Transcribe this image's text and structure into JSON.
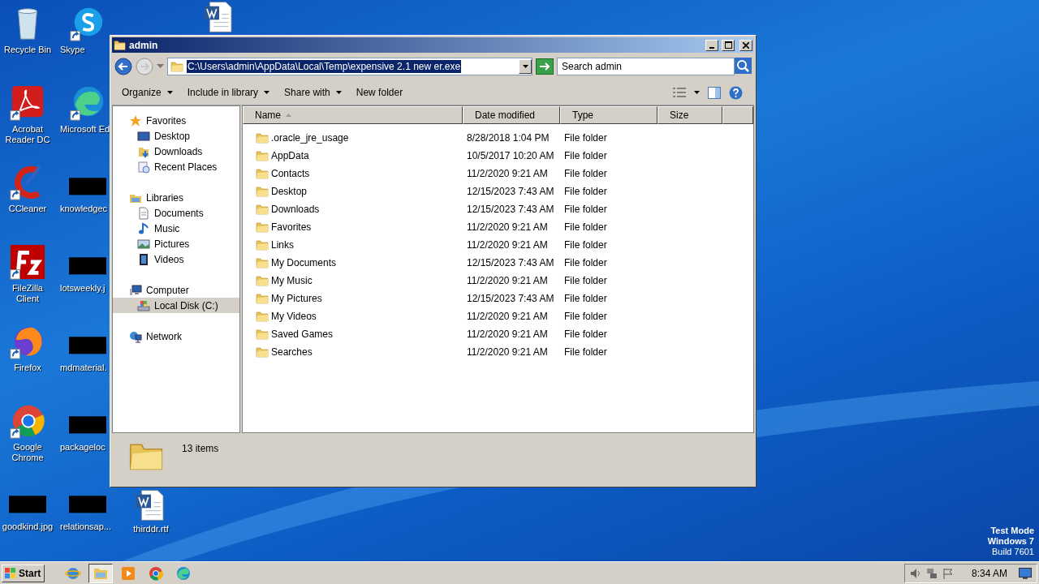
{
  "desktop": {
    "columns": [
      [
        {
          "kind": "recycle",
          "label": "Recycle Bin"
        },
        {
          "kind": "acrobat",
          "label": "Acrobat Reader DC"
        },
        {
          "kind": "ccleaner",
          "label": "CCleaner"
        },
        {
          "kind": "filezilla",
          "label": "FileZilla Client"
        },
        {
          "kind": "firefox",
          "label": "Firefox"
        },
        {
          "kind": "chrome",
          "label": "Google Chrome"
        },
        {
          "kind": "redacted",
          "label": "goodkind.jpg"
        }
      ],
      [
        {
          "kind": "skype",
          "label": "Skype"
        },
        {
          "kind": "edge",
          "label": "Microsoft Ed"
        },
        {
          "kind": "redacted",
          "label": "knowledgec"
        },
        {
          "kind": "redacted",
          "label": "lotsweekly.j"
        },
        {
          "kind": "redacted",
          "label": "mdmaterial."
        },
        {
          "kind": "redacted",
          "label": "packageloc"
        },
        {
          "kind": "redacted",
          "label": "relationsap..."
        }
      ],
      [
        {
          "kind": "word"
        },
        {
          "kind": "word",
          "label": "thirddr.rtf"
        }
      ]
    ],
    "os_notice": [
      "Test Mode",
      "Windows 7",
      "Build 7601"
    ]
  },
  "window": {
    "title": "admin",
    "address": {
      "value": "C:\\Users\\admin\\AppData\\Local\\Temp\\expensive 2.1 new er.exe",
      "highlighted": true
    },
    "search": {
      "placeholder": "Search admin"
    },
    "toolbar": [
      {
        "label": "Organize",
        "dropdown": true
      },
      {
        "label": "Include in library",
        "dropdown": true
      },
      {
        "label": "Share with",
        "dropdown": true
      },
      {
        "label": "New folder",
        "dropdown": false
      }
    ],
    "nav": [
      {
        "kind": "favorites",
        "label": "Favorites",
        "selected": false,
        "children": [
          {
            "kind": "desktop",
            "label": "Desktop",
            "selected": false
          },
          {
            "kind": "downloads",
            "label": "Downloads",
            "selected": false
          },
          {
            "kind": "recent",
            "label": "Recent Places",
            "selected": false
          }
        ]
      },
      {
        "kind": "libraries",
        "label": "Libraries",
        "selected": false,
        "children": [
          {
            "kind": "documents",
            "label": "Documents",
            "selected": false
          },
          {
            "kind": "music",
            "label": "Music",
            "selected": false
          },
          {
            "kind": "pictures",
            "label": "Pictures",
            "selected": false
          },
          {
            "kind": "videos",
            "label": "Videos",
            "selected": false
          }
        ]
      },
      {
        "kind": "computer",
        "label": "Computer",
        "selected": false,
        "children": [
          {
            "kind": "disk",
            "label": "Local Disk (C:)",
            "selected": true
          }
        ]
      },
      {
        "kind": "network",
        "label": "Network",
        "selected": false
      }
    ],
    "table": {
      "columns": [
        {
          "label": "Name",
          "sorted": true
        },
        {
          "label": "Date modified",
          "sorted": false
        },
        {
          "label": "Type",
          "sorted": false
        },
        {
          "label": "Size",
          "sorted": false
        }
      ],
      "rows": [
        {
          "name": ".oracle_jre_usage",
          "date": "8/28/2018 1:04 PM",
          "type": "File folder"
        },
        {
          "name": "AppData",
          "date": "10/5/2017 10:20 AM",
          "type": "File folder"
        },
        {
          "name": "Contacts",
          "date": "11/2/2020 9:21 AM",
          "type": "File folder"
        },
        {
          "name": "Desktop",
          "date": "12/15/2023 7:43 AM",
          "type": "File folder"
        },
        {
          "name": "Downloads",
          "date": "12/15/2023 7:43 AM",
          "type": "File folder"
        },
        {
          "name": "Favorites",
          "date": "11/2/2020 9:21 AM",
          "type": "File folder"
        },
        {
          "name": "Links",
          "date": "11/2/2020 9:21 AM",
          "type": "File folder"
        },
        {
          "name": "My Documents",
          "date": "12/15/2023 7:43 AM",
          "type": "File folder"
        },
        {
          "name": "My Music",
          "date": "11/2/2020 9:21 AM",
          "type": "File folder"
        },
        {
          "name": "My Pictures",
          "date": "12/15/2023 7:43 AM",
          "type": "File folder"
        },
        {
          "name": "My Videos",
          "date": "11/2/2020 9:21 AM",
          "type": "File folder"
        },
        {
          "name": "Saved Games",
          "date": "11/2/2020 9:21 AM",
          "type": "File folder"
        },
        {
          "name": "Searches",
          "date": "11/2/2020 9:21 AM",
          "type": "File folder"
        }
      ]
    },
    "details": {
      "count": "13 items"
    }
  },
  "taskbar": {
    "start": "Start",
    "apps": [
      {
        "kind": "ie",
        "selected": false
      },
      {
        "kind": "explorer",
        "selected": true
      },
      {
        "kind": "media",
        "selected": false
      },
      {
        "kind": "chrome",
        "selected": false
      },
      {
        "kind": "edge",
        "selected": false
      }
    ],
    "clock": "8:34 AM"
  }
}
